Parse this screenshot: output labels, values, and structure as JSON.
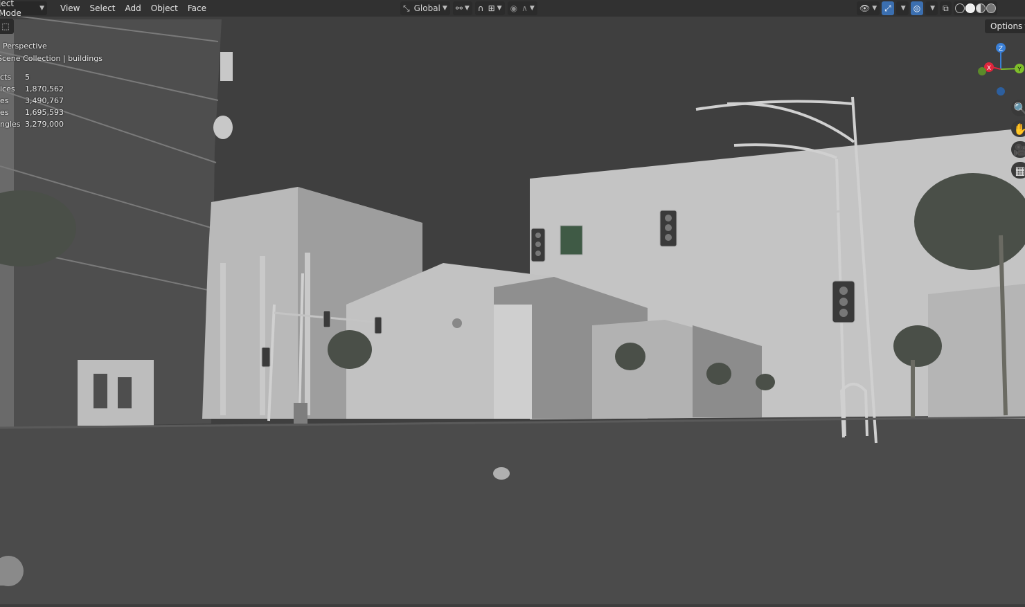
{
  "header": {
    "mode": "ject Mode",
    "menu": [
      "View",
      "Select",
      "Add",
      "Object",
      "Face"
    ],
    "transform_orientation": "Global"
  },
  "options_label": "Options",
  "viewport_info": {
    "view": "Perspective",
    "collection": "Scene Collection | buildings",
    "stats": [
      {
        "label": "cts",
        "value": "5"
      },
      {
        "label": "ices",
        "value": "1,870,562"
      },
      {
        "label": "es",
        "value": "3,490,767"
      },
      {
        "label": "es",
        "value": "1,695,593"
      },
      {
        "label": "ngles",
        "value": "3,279,000"
      }
    ]
  },
  "gizmo": {
    "x": "X",
    "y": "Y",
    "z": "Z"
  },
  "icons": [
    "select-box-icon",
    "transform-orientation-icon",
    "snap-icon",
    "proportional-edit-icon",
    "visibility-icon",
    "gizmo-toggle-icon",
    "overlay-icon",
    "xray-icon",
    "zoom-icon",
    "hand-icon",
    "camera-icon",
    "grid-icon"
  ],
  "colors": {
    "accent": "#3b6fb0",
    "axis_x": "#e0263c",
    "axis_y": "#7fbf2a",
    "axis_z": "#3a7fd6"
  }
}
